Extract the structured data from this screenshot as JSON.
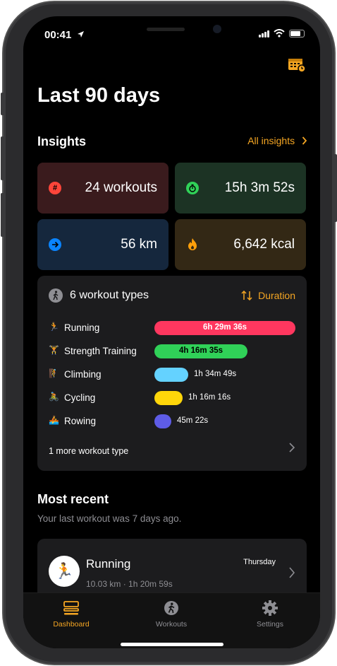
{
  "status": {
    "time": "00:41"
  },
  "header": {
    "title": "Last 90 days"
  },
  "insights": {
    "title": "Insights",
    "link_label": "All insights",
    "tiles": [
      {
        "value": "24 workouts",
        "icon": "hash-icon",
        "color": "#ff453a"
      },
      {
        "value": "15h 3m 52s",
        "icon": "stopwatch-icon",
        "color": "#30d158"
      },
      {
        "value": "56 km",
        "icon": "arrow-right-icon",
        "color": "#0a84ff"
      },
      {
        "value": "6,642 kcal",
        "icon": "flame-icon",
        "color": "#ff9f0a"
      }
    ]
  },
  "workout_types": {
    "title": "6 workout types",
    "sort_label": "Duration",
    "rows": [
      {
        "name": "Running",
        "duration": "6h 29m 36s",
        "fraction": 1.0,
        "color": "#ff375f",
        "icon": "running-icon"
      },
      {
        "name": "Strength Training",
        "duration": "4h 16m 35s",
        "fraction": 0.66,
        "color": "#30d158",
        "icon": "weightlifting-icon"
      },
      {
        "name": "Climbing",
        "duration": "1h 34m 49s",
        "fraction": 0.24,
        "color": "#64d2ff",
        "icon": "climbing-icon"
      },
      {
        "name": "Cycling",
        "duration": "1h 16m 16s",
        "fraction": 0.2,
        "color": "#ffd60a",
        "icon": "cycling-icon"
      },
      {
        "name": "Rowing",
        "duration": "45m 22s",
        "fraction": 0.12,
        "color": "#5e5ce6",
        "icon": "rowing-icon"
      }
    ],
    "more_label": "1 more workout type"
  },
  "most_recent": {
    "title": "Most recent",
    "subtitle": "Your last workout was 7 days ago.",
    "card": {
      "title": "Running",
      "day": "Thursday",
      "meta": "10.03 km · 1h 20m 59s"
    }
  },
  "tabs": [
    {
      "label": "Dashboard",
      "active": true
    },
    {
      "label": "Workouts",
      "active": false
    },
    {
      "label": "Settings",
      "active": false
    }
  ],
  "accent_color": "#f5a623"
}
